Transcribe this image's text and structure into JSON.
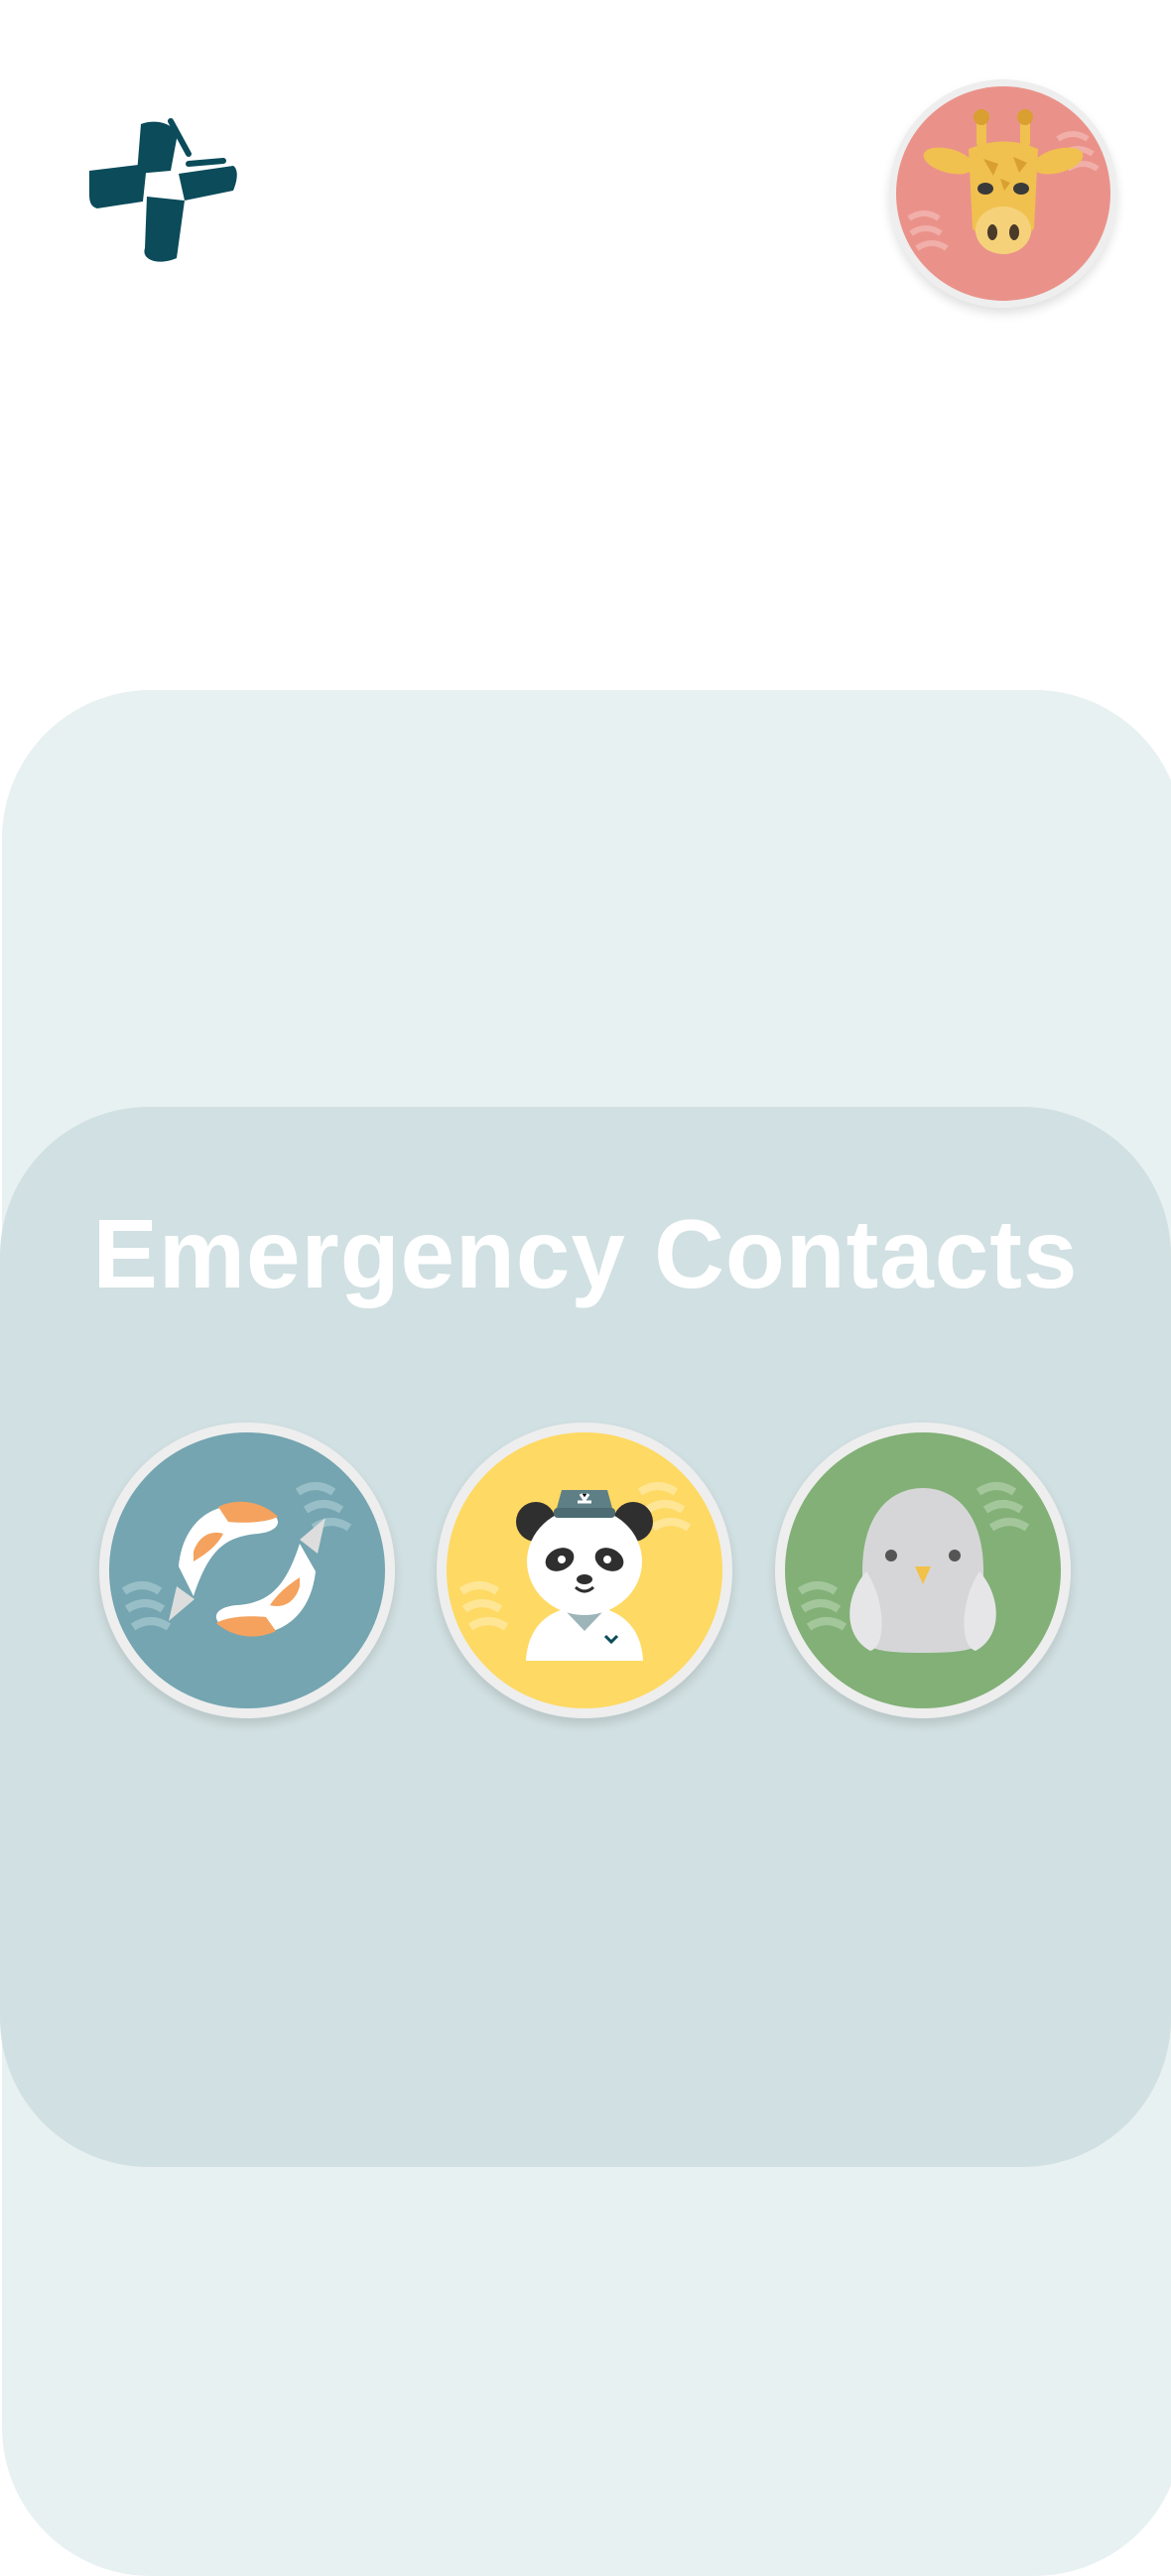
{
  "header": {
    "logo_icon": "medical-cross-logo-icon",
    "logo_color": "#0b4b5a",
    "profile_avatar": {
      "icon": "giraffe-icon",
      "background": "#ea928a"
    }
  },
  "contacts_section": {
    "title": "Emergency Contacts",
    "contacts": [
      {
        "icon": "koi-fish-icon",
        "background": "#74a5b1"
      },
      {
        "icon": "panda-doctor-icon",
        "background": "#fed963"
      },
      {
        "icon": "gray-bird-icon",
        "background": "#82b077"
      }
    ]
  },
  "colors": {
    "page_background": "#ffffff",
    "outer_panel": "#e8f1f1",
    "contacts_card": "#d1e0e2",
    "avatar_ring": "#eeeeee"
  }
}
